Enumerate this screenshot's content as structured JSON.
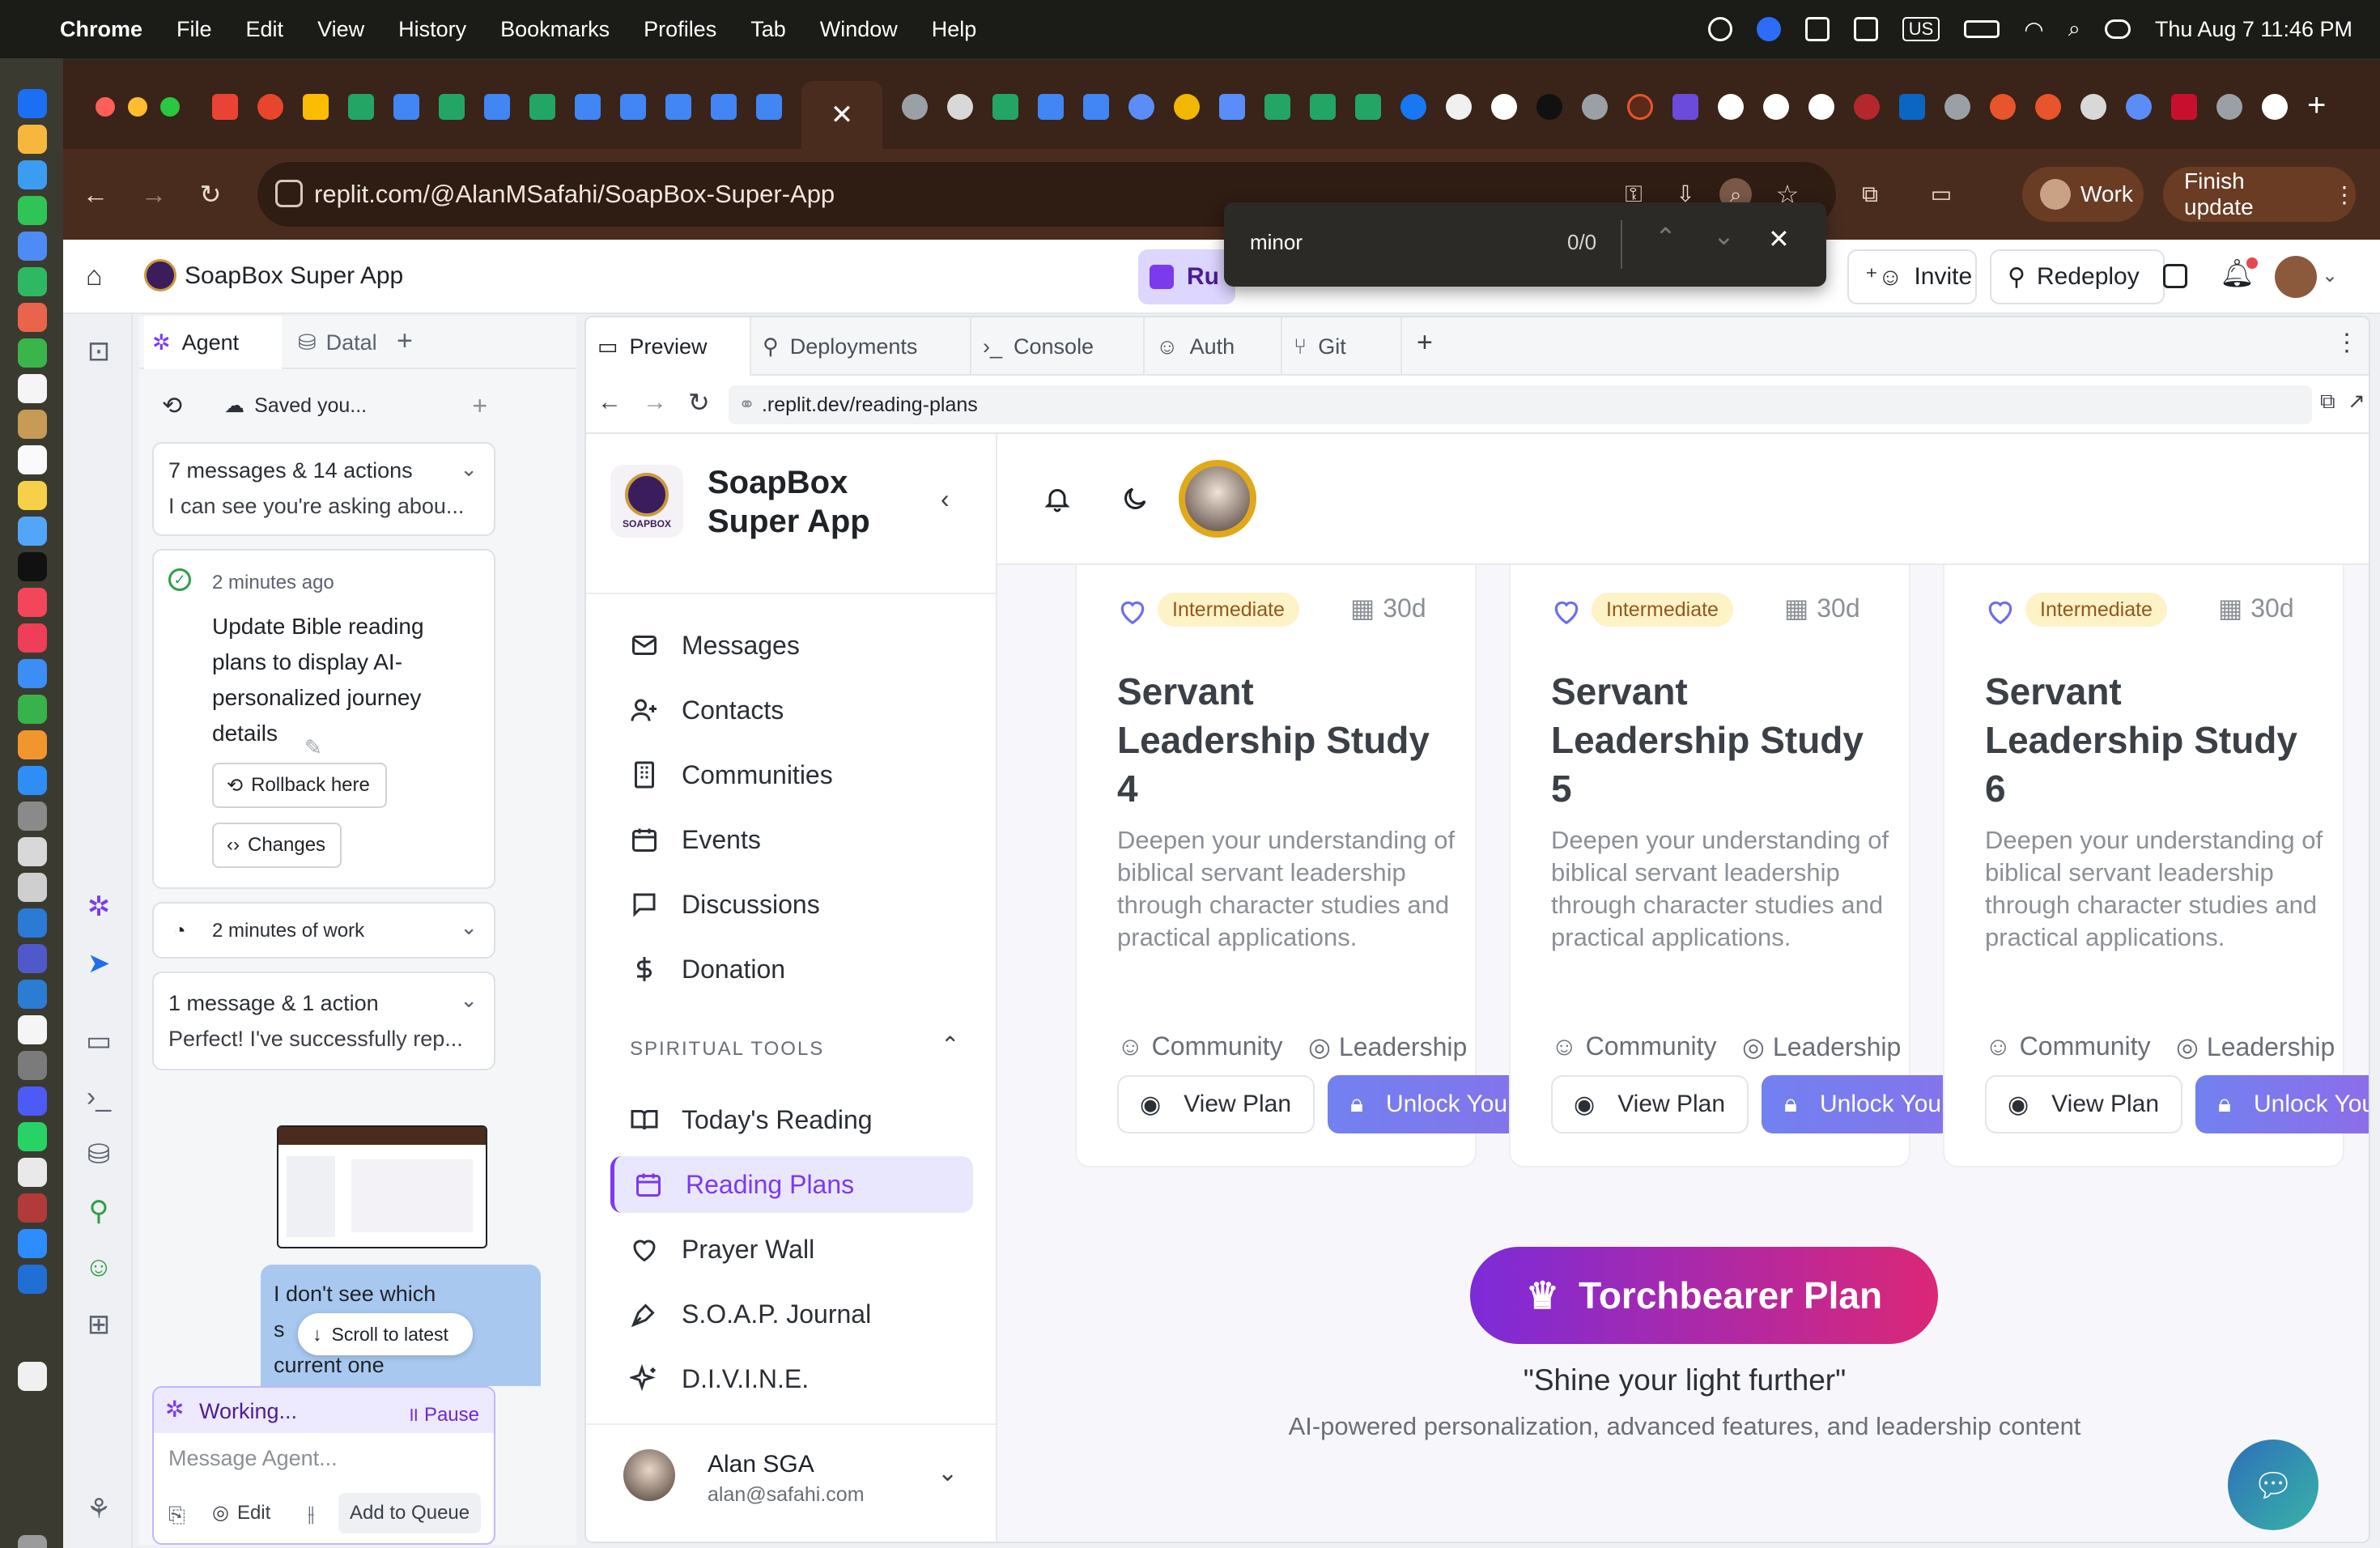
{
  "menubar": {
    "app": "Chrome",
    "items": [
      "File",
      "Edit",
      "View",
      "History",
      "Bookmarks",
      "Profiles",
      "Tab",
      "Window",
      "Help"
    ],
    "keyboard": "US",
    "datetime": "Thu Aug 7  11:46 PM"
  },
  "browser": {
    "url": "replit.com/@AlanMSafahi/SoapBox-Super-App",
    "profile": "Work",
    "update_button": "Finish update"
  },
  "find": {
    "query": "minor",
    "count": "0/0"
  },
  "replit": {
    "project": "SoapBox Super App",
    "run_label": "Ru",
    "invite": "Invite",
    "redeploy": "Redeploy"
  },
  "agent": {
    "tabs": [
      "Agent",
      "Datal"
    ],
    "saved": "Saved you...",
    "summary1": {
      "title": "7 messages & 14 actions",
      "text": "I can see you're asking abou..."
    },
    "checkpoint": {
      "time": "2 minutes ago",
      "text": "Update Bible reading plans to display AI-personalized journey details",
      "rollback": "Rollback here",
      "changes": "Changes"
    },
    "work": "2 minutes of work",
    "summary2": {
      "title": "1 message & 1 action",
      "text": "Perfect! I've successfully rep..."
    },
    "user_msg": [
      "I don't see which",
      "s",
      "current one"
    ],
    "scroll_latest": "Scroll to latest",
    "working": "Working...",
    "pause": "Pause",
    "placeholder": "Message Agent...",
    "edit": "Edit",
    "queue": "Add to Queue"
  },
  "preview": {
    "tabs": [
      "Preview",
      "Deployments",
      "Console",
      "Auth",
      "Git"
    ],
    "address": ".replit.dev/reading-plans"
  },
  "app": {
    "brand": [
      "SoapBox",
      "Super App"
    ],
    "logo_text": "SOAPBOX",
    "nav": [
      "Messages",
      "Contacts",
      "Communities",
      "Events",
      "Discussions",
      "Donation"
    ],
    "section": "SPIRITUAL TOOLS",
    "tools": [
      "Today's Reading",
      "Reading Plans",
      "Prayer Wall",
      "S.O.A.P. Journal",
      "D.I.V.I.N.E."
    ],
    "active_tool": "Reading Plans",
    "user": {
      "name": "Alan SGA",
      "email": "alan@safahi.com"
    },
    "plans": [
      {
        "level": "Intermediate",
        "days": "30d",
        "title": "Servant Leadership Study 4",
        "desc": "Deepen your understanding of biblical servant leadership through character studies and practical applications.",
        "tags": [
          "Community",
          "Leadership"
        ],
        "view": "View Plan",
        "unlock": "Unlock Your Calling"
      },
      {
        "level": "Intermediate",
        "days": "30d",
        "title": "Servant Leadership Study 5",
        "desc": "Deepen your understanding of biblical servant leadership through character studies and practical applications.",
        "tags": [
          "Community",
          "Leadership"
        ],
        "view": "View Plan",
        "unlock": "Unlock Your Calling"
      },
      {
        "level": "Intermediate",
        "days": "30d",
        "title": "Servant Leadership Study 6",
        "desc": "Deepen your understanding of biblical servant leadership through character studies and practical applications.",
        "tags": [
          "Community",
          "Leadership"
        ],
        "view": "View Plan",
        "unlock": "Unlock Your Calling"
      }
    ],
    "torchbearer": {
      "title": "Torchbearer Plan",
      "quote": "\"Shine your light further\"",
      "subtitle": "AI-powered personalization, advanced features, and leadership content"
    }
  },
  "colors": {
    "accent": "#7c3aed",
    "brand_gradient_start": "#7c2bd9",
    "brand_gradient_end": "#db2777",
    "active_nav": "#e9e7fd"
  }
}
